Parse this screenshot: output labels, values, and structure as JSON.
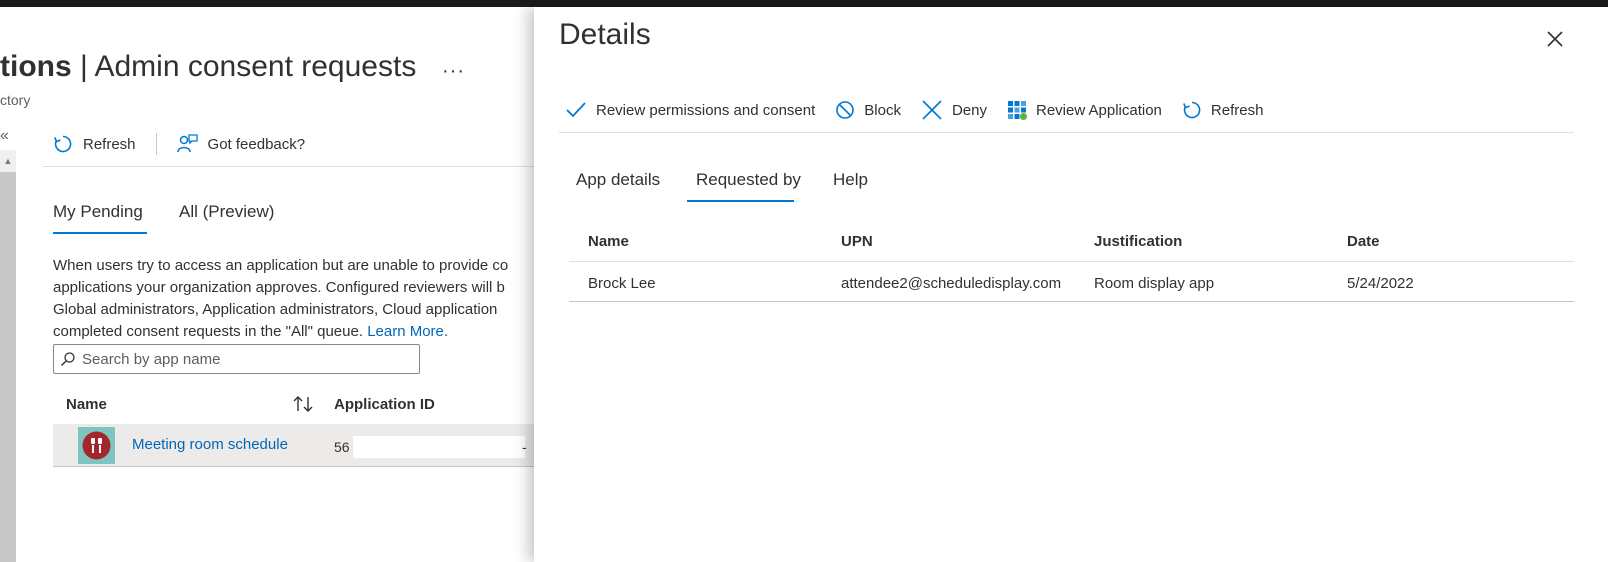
{
  "page": {
    "title_bold": "tions",
    "title_rest": " | Admin consent requests",
    "more_label": "···",
    "subtitle": "ctory",
    "collapse_label": "«",
    "scroll_up_label": "▲",
    "toolbar": {
      "refresh_label": "Refresh",
      "feedback_label": "Got feedback?"
    },
    "tabs": [
      {
        "label": "My Pending"
      },
      {
        "label": "All (Preview)"
      }
    ],
    "description_lines": [
      "When users try to access an application but are unable to provide co",
      "applications your organization approves. Configured reviewers will b",
      "Global administrators, Application administrators, Cloud application",
      "completed consent requests in the \"All\" queue. "
    ],
    "learn_more": "Learn More.",
    "search_placeholder": "Search by app name",
    "table": {
      "headers": {
        "name": "Name",
        "app_id": "Application ID"
      },
      "row": {
        "name": "Meeting room schedule",
        "app_id_prefix": "56",
        "app_id_suffix": "-"
      }
    }
  },
  "panel": {
    "title": "Details",
    "commands": [
      {
        "label": "Review permissions and consent",
        "icon": "checkmark-icon"
      },
      {
        "label": "Block",
        "icon": "block-icon"
      },
      {
        "label": "Deny",
        "icon": "deny-x-icon"
      },
      {
        "label": "Review Application",
        "icon": "app-grid-icon"
      },
      {
        "label": "Refresh",
        "icon": "refresh-icon"
      }
    ],
    "tabs": [
      {
        "label": "App details"
      },
      {
        "label": "Requested by",
        "active": true
      },
      {
        "label": "Help"
      }
    ],
    "table": {
      "headers": [
        "Name",
        "UPN",
        "Justification",
        "Date"
      ],
      "rows": [
        [
          "Brock Lee",
          "attendee2@scheduledisplay.com",
          "Room display app",
          "5/24/2022"
        ]
      ]
    }
  },
  "colors": {
    "accent": "#0078d4",
    "link": "#0067b8",
    "text": "#323130",
    "topbar": "#1b1a19"
  }
}
